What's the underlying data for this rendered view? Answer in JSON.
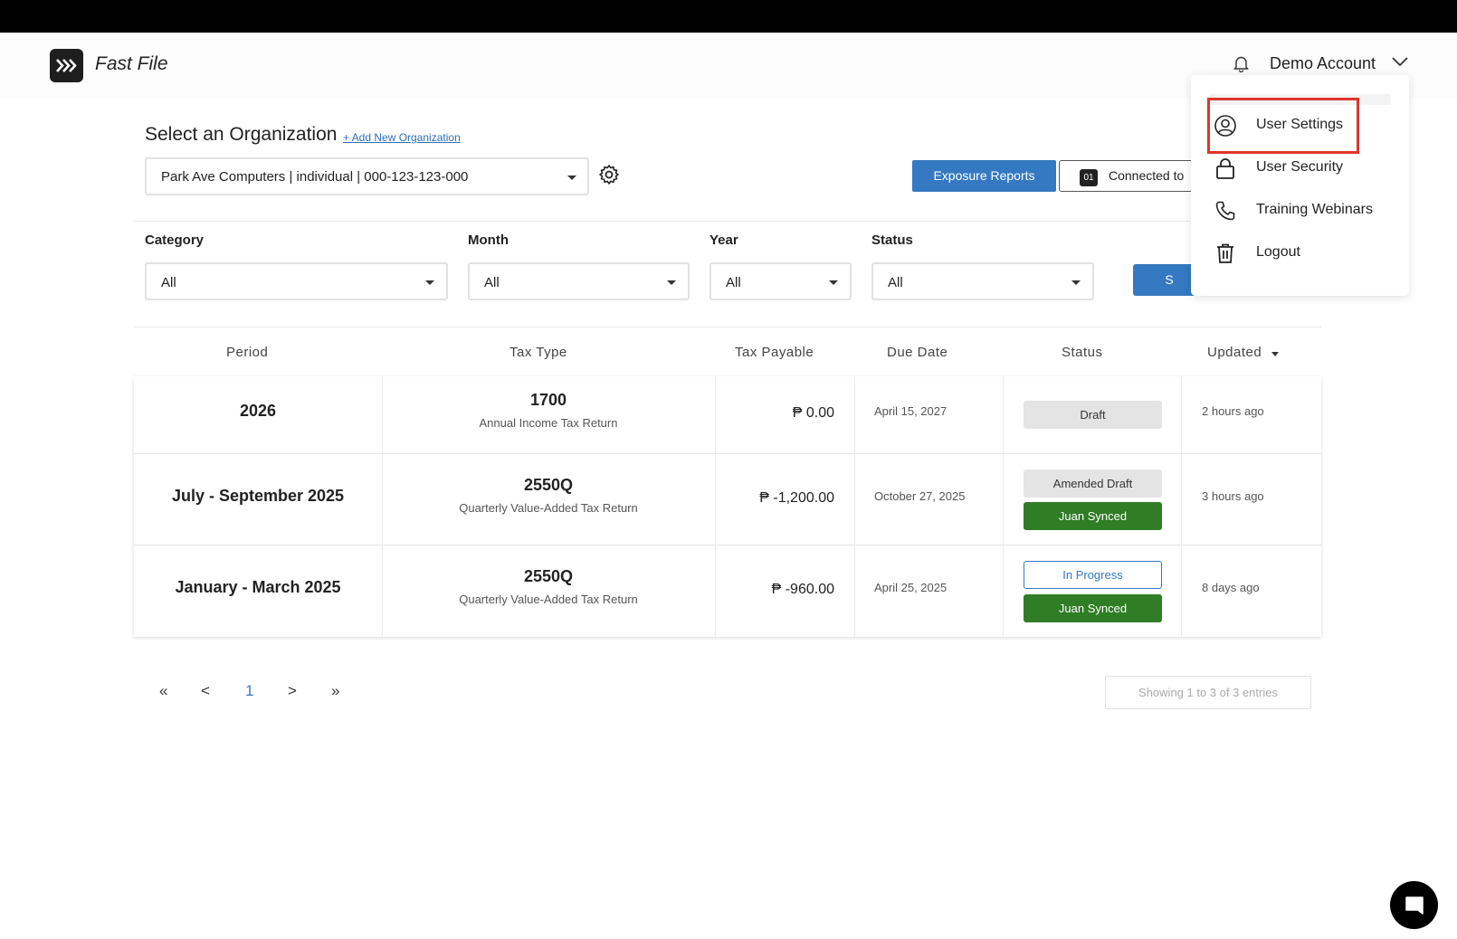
{
  "header": {
    "app_title": "Fast File",
    "account_name": "Demo Account"
  },
  "org": {
    "title": "Select an Organization",
    "add_link": "+ Add New Organization",
    "selected": "Park Ave Computers | individual | 000-123-123-000",
    "exposure_button": "Exposure Reports",
    "connected_badge": "01",
    "connected_label": "Connected to"
  },
  "filters": {
    "category": {
      "label": "Category",
      "value": "All"
    },
    "month": {
      "label": "Month",
      "value": "All"
    },
    "year": {
      "label": "Year",
      "value": "All"
    },
    "status": {
      "label": "Status",
      "value": "All"
    },
    "search_button": "S"
  },
  "table": {
    "headers": [
      "Period",
      "Tax Type",
      "Tax Payable",
      "Due Date",
      "Status",
      "Updated"
    ],
    "rows": [
      {
        "period": "2026",
        "tax_code": "1700",
        "tax_name": "Annual Income Tax Return",
        "payable": "₱ 0.00",
        "due": "April 15, 2027",
        "status": [
          "Draft"
        ],
        "updated": "2 hours ago"
      },
      {
        "period": "July - September 2025",
        "tax_code": "2550Q",
        "tax_name": "Quarterly Value-Added Tax Return",
        "payable": "₱ -1,200.00",
        "due": "October 27, 2025",
        "status": [
          "Amended Draft",
          "Juan Synced"
        ],
        "updated": "3 hours ago"
      },
      {
        "period": "January - March 2025",
        "tax_code": "2550Q",
        "tax_name": "Quarterly Value-Added Tax Return",
        "payable": "₱ -960.00",
        "due": "April 25, 2025",
        "status": [
          "In Progress",
          "Juan Synced"
        ],
        "updated": "8 days ago"
      }
    ]
  },
  "pagination": {
    "first": "«",
    "prev": "<",
    "current": "1",
    "next": ">",
    "last": "»",
    "entries": "Showing 1 to 3 of 3 entries"
  },
  "menu": {
    "items": [
      {
        "label": "User Settings",
        "icon": "user-circle-icon"
      },
      {
        "label": "User Security",
        "icon": "lock-icon"
      },
      {
        "label": "Training Webinars",
        "icon": "phone-icon"
      },
      {
        "label": "Logout",
        "icon": "trash-icon"
      }
    ]
  },
  "colors": {
    "primary": "#3479c1",
    "synced": "#2f7d25",
    "highlight": "#e0352b"
  }
}
